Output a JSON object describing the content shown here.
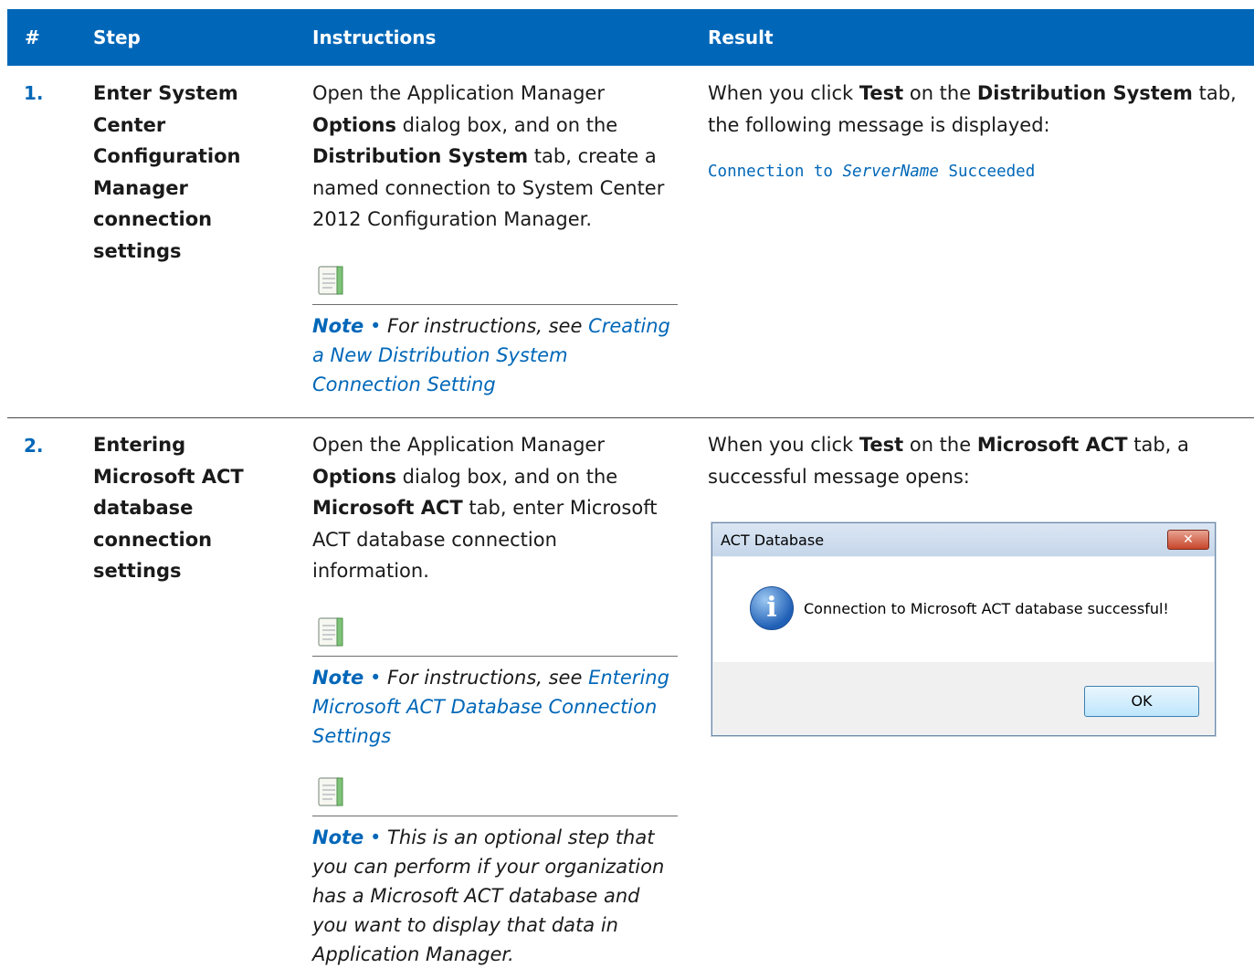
{
  "header": {
    "num": "#",
    "step": "Step",
    "instructions": "Instructions",
    "result": "Result"
  },
  "rows": [
    {
      "num": "1.",
      "step": "Enter System Center Configuration Manager connection settings",
      "instr": {
        "a": "Open the Application Manager ",
        "b1": "Options",
        "c": " dialog box, and on the ",
        "b2": "Distribution System",
        "d": " tab, create a named connection to System Center 2012 Configuration Manager."
      },
      "note": {
        "label": "Note",
        "bullet": "•",
        "text": " For instructions, see ",
        "link": "Creating a New Distribution System Connection Setting"
      },
      "result": {
        "a": "When you click ",
        "b1": "Test",
        "c": " on the ",
        "b2": "Distribution System",
        "d": " tab, the following message is displayed:"
      },
      "code": {
        "a": "Connection to ",
        "b": "ServerName",
        "c": " Succeeded"
      }
    },
    {
      "num": "2.",
      "step": "Entering Microsoft ACT database connection settings",
      "instr": {
        "a": "Open the Application Manager ",
        "b1": "Options",
        "c": " dialog box, and on the ",
        "b2": "Microsoft ACT",
        "d": " tab, enter Microsoft ACT database connection information."
      },
      "note1": {
        "label": "Note",
        "bullet": "•",
        "text": " For instructions, see ",
        "link": "Entering Microsoft ACT Database Connection Settings"
      },
      "note2": {
        "label": "Note",
        "bullet": "•",
        "text": " This is an optional step that you can perform if your organization has a Microsoft ACT database and you want to display that data in Application Manager."
      },
      "result": {
        "a": "When you click ",
        "b1": "Test",
        "c": " on the ",
        "b2": "Microsoft ACT",
        "d": " tab, a successful message opens:"
      },
      "dialog": {
        "title": "ACT Database",
        "close": "✕",
        "message": "Connection to Microsoft ACT database successful!",
        "ok": "OK",
        "info_glyph": "i"
      }
    }
  ]
}
